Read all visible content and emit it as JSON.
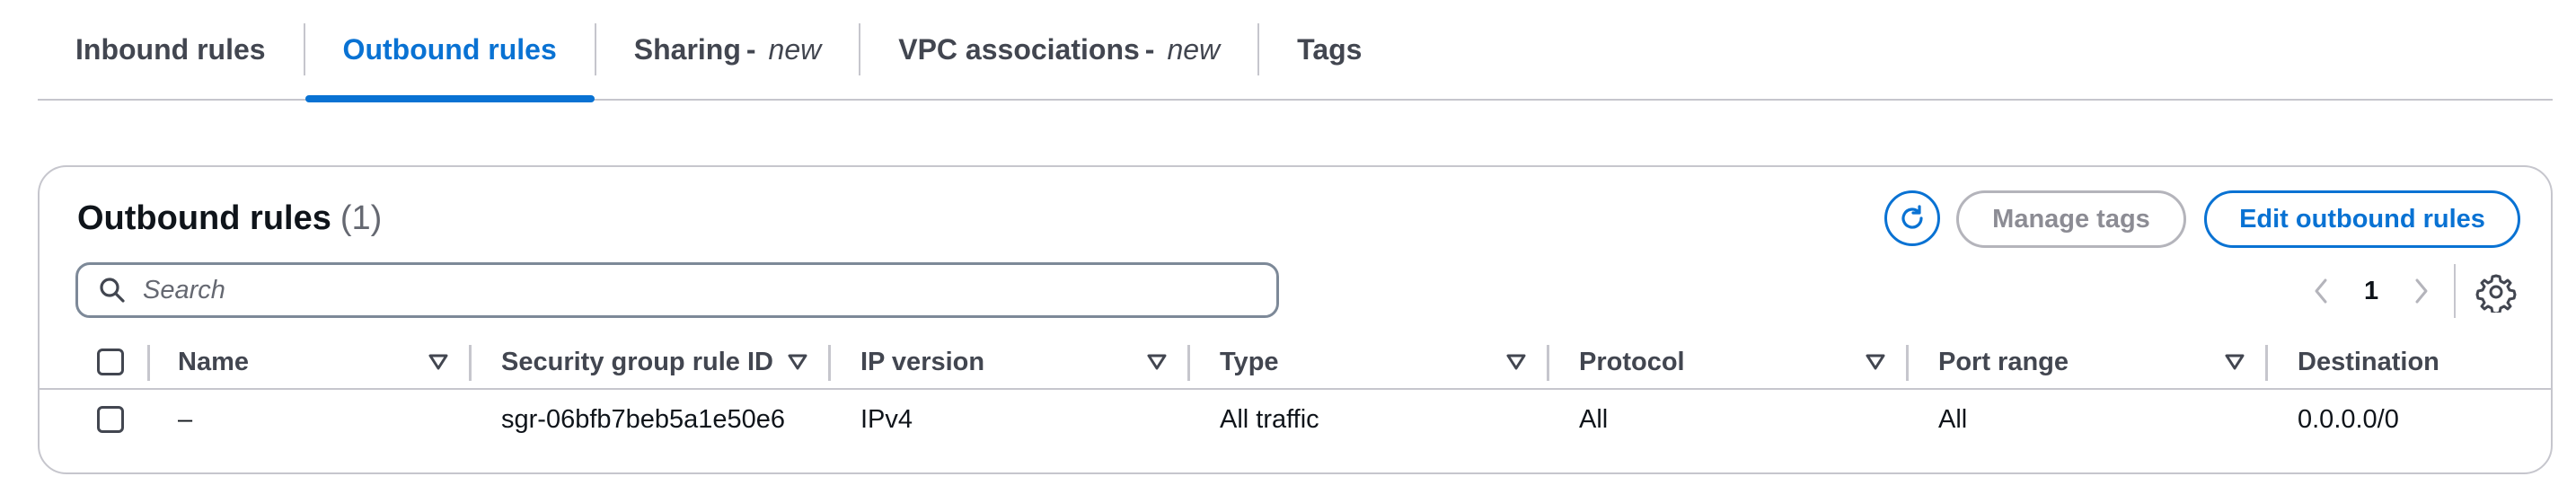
{
  "tabs": [
    {
      "label": "Inbound rules",
      "suffix": ""
    },
    {
      "label": "Outbound rules",
      "suffix": ""
    },
    {
      "label": "Sharing",
      "suffix": "new"
    },
    {
      "label": "VPC associations",
      "suffix": "new"
    },
    {
      "label": "Tags",
      "suffix": ""
    }
  ],
  "active_tab": "Outbound rules",
  "panel": {
    "title": "Outbound rules",
    "count": "(1)",
    "manage_tags_label": "Manage tags",
    "edit_label": "Edit outbound rules",
    "search_placeholder": "Search",
    "page": "1"
  },
  "table": {
    "columns": [
      "Name",
      "Security group rule ID",
      "IP version",
      "Type",
      "Protocol",
      "Port range",
      "Destination"
    ],
    "rows": [
      [
        "–",
        "sgr-06bfb7beb5a1e50e6",
        "IPv4",
        "All traffic",
        "All",
        "All",
        "0.0.0.0/0"
      ]
    ]
  },
  "colors": {
    "accent": "#0972d3",
    "border": "#c6c6cd",
    "muted_text": "#656871"
  },
  "icons": [
    "refresh-icon",
    "search-icon",
    "chevron-left-icon",
    "chevron-right-icon",
    "settings-gear-icon",
    "sort-caret-icon"
  ]
}
